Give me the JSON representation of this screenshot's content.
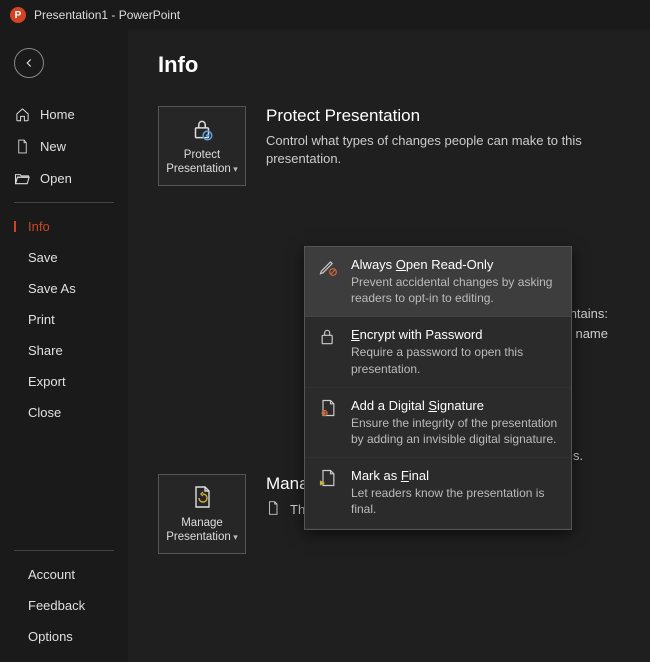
{
  "titlebar": {
    "title": "Presentation1  -  PowerPoint"
  },
  "nav": {
    "home": "Home",
    "new": "New",
    "open": "Open",
    "info": "Info",
    "save": "Save",
    "save_as": "Save As",
    "print": "Print",
    "share": "Share",
    "export": "Export",
    "close": "Close",
    "account": "Account",
    "feedback": "Feedback",
    "options": "Options"
  },
  "page": {
    "title": "Info"
  },
  "protect": {
    "button": "Protect Presentation",
    "heading": "Protect Presentation",
    "desc": "Control what types of changes people can make to this presentation."
  },
  "inspect_fragments": {
    "line1_suffix": "are that it contains:",
    "line2_suffix": "uthor's name"
  },
  "dropdown": {
    "items": [
      {
        "title_pre": "Always ",
        "title_ul": "O",
        "title_post": "pen Read-Only",
        "desc": "Prevent accidental changes by asking readers to opt-in to editing."
      },
      {
        "title_pre": "",
        "title_ul": "E",
        "title_post": "ncrypt with Password",
        "desc": "Require a password to open this presentation."
      },
      {
        "title_pre": "Add a Digital ",
        "title_ul": "S",
        "title_post": "ignature",
        "desc": "Ensure the integrity of the presentation by adding an invisible digital signature."
      },
      {
        "title_pre": "Mark as ",
        "title_ul": "F",
        "title_post": "inal",
        "desc": "Let readers know the presentation is final."
      }
    ]
  },
  "history_fragment": "s.",
  "manage": {
    "button": "Manage Presentation",
    "heading": "Manage Presentation",
    "desc": "There are no unsaved changes."
  }
}
